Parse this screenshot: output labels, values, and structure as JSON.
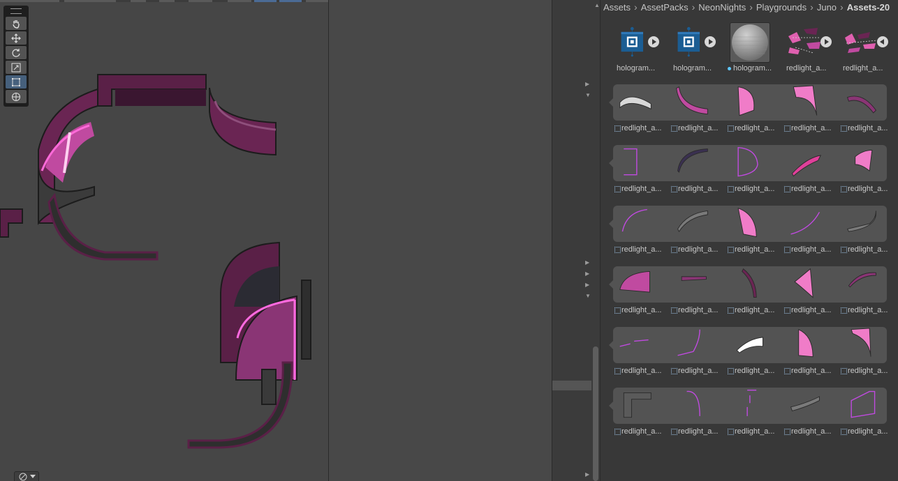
{
  "breadcrumb": [
    "Assets",
    "AssetPacks",
    "NeonNights",
    "Playgrounds",
    "Juno",
    "Assets-20"
  ],
  "top_items": [
    {
      "label": "hologram...",
      "kind": "prefab"
    },
    {
      "label": "hologram...",
      "kind": "prefab"
    },
    {
      "label": "hologram...",
      "kind": "material"
    },
    {
      "label": "redlight_a...",
      "kind": "model"
    },
    {
      "label": "redlight_a...",
      "kind": "model"
    }
  ],
  "rows": [
    [
      "redlight_a...",
      "redlight_a...",
      "redlight_a...",
      "redlight_a...",
      "redlight_a..."
    ],
    [
      "redlight_a...",
      "redlight_a...",
      "redlight_a...",
      "redlight_a...",
      "redlight_a..."
    ],
    [
      "redlight_a...",
      "redlight_a...",
      "redlight_a...",
      "redlight_a...",
      "redlight_a..."
    ],
    [
      "redlight_a...",
      "redlight_a...",
      "redlight_a...",
      "redlight_a...",
      "redlight_a..."
    ],
    [
      "redlight_a...",
      "redlight_a...",
      "redlight_a...",
      "redlight_a...",
      "redlight_a..."
    ],
    [
      "redlight_a...",
      "redlight_a...",
      "redlight_a...",
      "redlight_a...",
      "redlight_a..."
    ]
  ],
  "tools": [
    "hand-tool",
    "move-tool",
    "rotate-tool",
    "scale-tool",
    "rect-tool",
    "transform-tool"
  ],
  "active_tool": "rect-tool",
  "colors": {
    "accent": "#46607c",
    "prefab_blue": "#1b5d93",
    "neon_pink": "#e06bc0",
    "neon_purple": "#c040ff"
  }
}
